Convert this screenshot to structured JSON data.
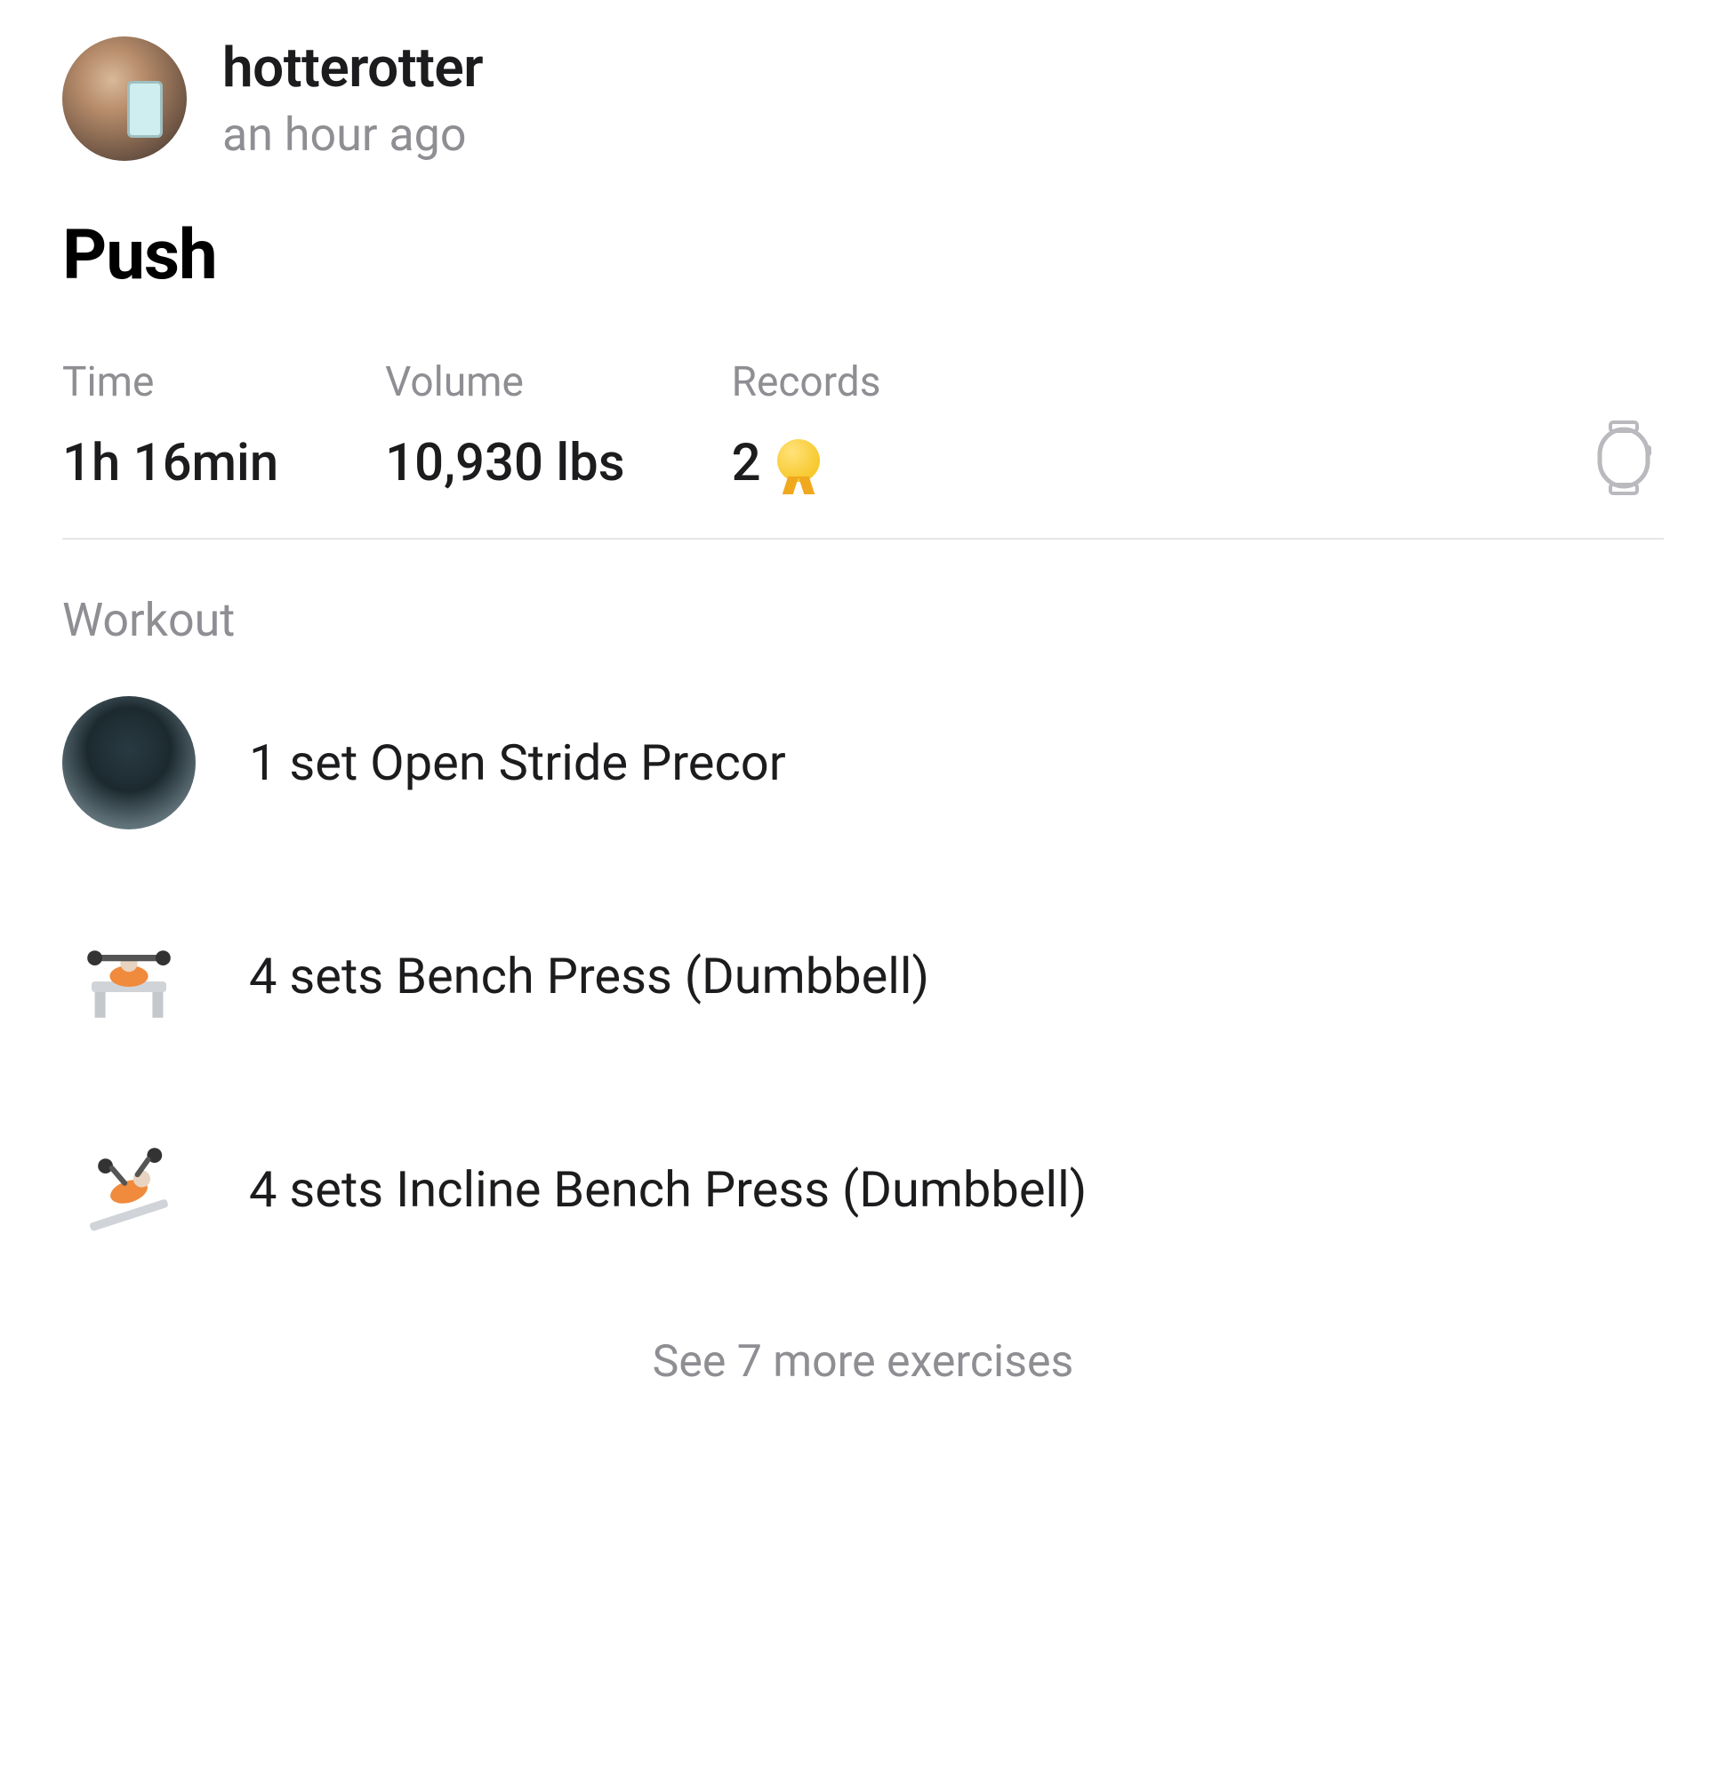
{
  "user": {
    "name": "hotterotter",
    "posted_ago": "an hour ago"
  },
  "workout": {
    "title": "Push",
    "stats": {
      "time_label": "Time",
      "time_value": "1h 16min",
      "volume_label": "Volume",
      "volume_value": "10,930 lbs",
      "records_label": "Records",
      "records_value": "2"
    },
    "section_label": "Workout",
    "exercises": [
      {
        "summary": "1 set Open Stride Precor"
      },
      {
        "summary": "4 sets Bench Press (Dumbbell)"
      },
      {
        "summary": "4 sets Incline Bench Press (Dumbbell)"
      }
    ],
    "see_more": "See 7 more exercises"
  }
}
